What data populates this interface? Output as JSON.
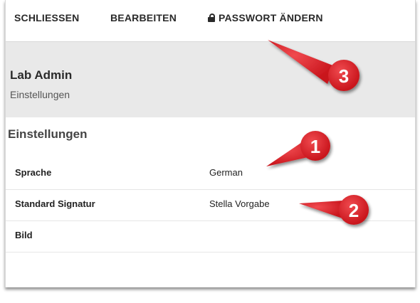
{
  "toolbar": {
    "close_label": "SCHLIESSEN",
    "edit_label": "BEARBEITEN",
    "password_label": "PASSWORT ÄNDERN",
    "password_icon": "lock-icon"
  },
  "header": {
    "user_name": "Lab Admin",
    "subtitle": "Einstellungen"
  },
  "settings": {
    "title": "Einstellungen",
    "rows": [
      {
        "label": "Sprache",
        "value": "German"
      },
      {
        "label": "Standard Signatur",
        "value": "Stella Vorgabe"
      },
      {
        "label": "Bild",
        "value": ""
      }
    ]
  },
  "callouts": [
    "1",
    "2",
    "3"
  ],
  "colors": {
    "callout_red": "#d91f26",
    "header_band": "#e9e9e9",
    "text_dark": "#2a2a2a"
  }
}
